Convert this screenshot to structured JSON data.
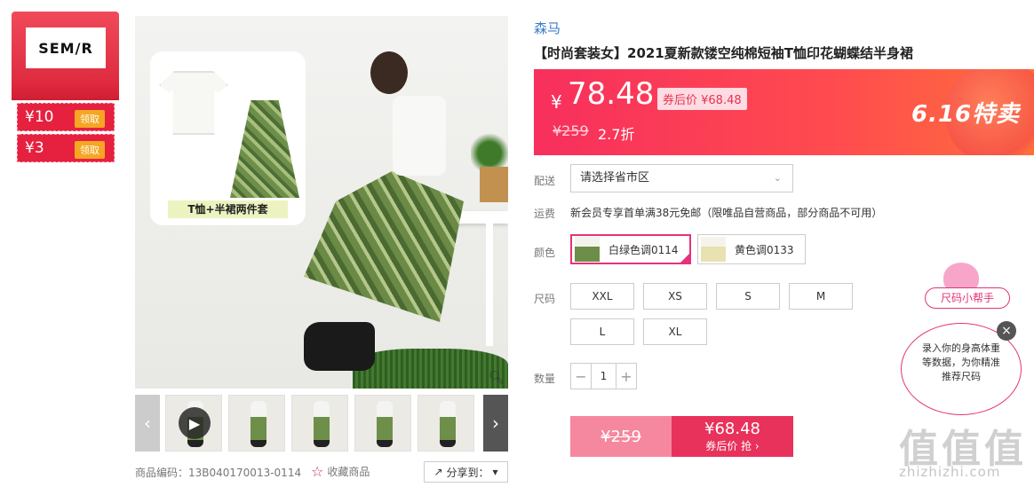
{
  "store": {
    "logo_text": "SEM/R"
  },
  "coupons": [
    {
      "value": "¥10",
      "action": "领取"
    },
    {
      "value": "¥3",
      "action": "领取"
    }
  ],
  "gallery": {
    "inset_label": "T恤+半裙两件套",
    "prev_icon": "chevron-left-icon",
    "next_icon": "chevron-right-icon",
    "thumb_count": 6
  },
  "product": {
    "brand": "森马",
    "title": "【时尚套装女】2021夏新款镂空纯棉短袖T恤印花蝴蝶结半身裙",
    "code_label": "商品编码：13B040170013-0114",
    "favorite_label": "收藏商品",
    "share_label": "分享到："
  },
  "price": {
    "currency": "¥",
    "current": "78.48",
    "after_coupon": "券后价 ¥68.48",
    "original": "¥259",
    "discount": "2.7折",
    "promo": "6.16特卖"
  },
  "delivery": {
    "label": "配送",
    "select_value": "请选择省市区"
  },
  "shipping": {
    "label": "运费",
    "text": "新会员专享首单满38元免邮（限唯品自营商品，部分商品不可用）"
  },
  "colors": {
    "label": "颜色",
    "options": [
      {
        "name": "白绿色调0114",
        "selected": true
      },
      {
        "name": "黄色调0133",
        "selected": false
      }
    ]
  },
  "sizes": {
    "label": "尺码",
    "options": [
      "XXL",
      "XS",
      "S",
      "M",
      "L",
      "XL"
    ]
  },
  "quantity": {
    "label": "数量",
    "value": "1",
    "minus": "−",
    "plus": "+"
  },
  "buy": {
    "original": "¥259",
    "coupon_price": "¥68.48",
    "coupon_action": "券后价 抢 ›"
  },
  "size_helper": {
    "tag": "尺码小帮手",
    "bubble": "录入你的身高体重等数据，为你精准推荐尺码",
    "close": "×"
  },
  "watermark": {
    "text": "值值值",
    "url": "zhizhizhi.com"
  },
  "colors_theme": {
    "accent": "#e5327a",
    "price_red": "#f72f5d",
    "brand_blue": "#3a7cc8"
  }
}
